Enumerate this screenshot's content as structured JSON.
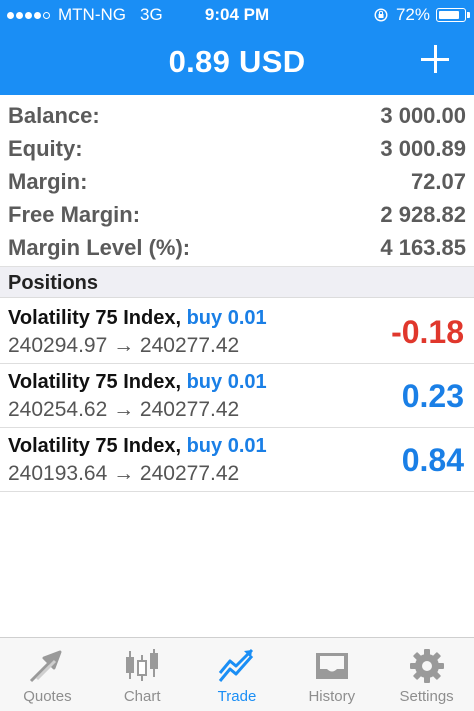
{
  "status_bar": {
    "carrier": "MTN-NG",
    "network": "3G",
    "time": "9:04 PM",
    "battery": "72%"
  },
  "header": {
    "title": "0.89 USD",
    "add_icon": "plus-icon"
  },
  "summary": [
    {
      "label": "Balance:",
      "value": "3 000.00"
    },
    {
      "label": "Equity:",
      "value": "3 000.89"
    },
    {
      "label": "Margin:",
      "value": "72.07"
    },
    {
      "label": "Free Margin:",
      "value": "2 928.82"
    },
    {
      "label": "Margin Level (%):",
      "value": "4 163.85"
    }
  ],
  "positions_header": "Positions",
  "positions": [
    {
      "symbol": "Volatility 75 Index,",
      "type": "buy 0.01",
      "prices": "240294.97 → 240277.42",
      "profit": "-0.18"
    },
    {
      "symbol": "Volatility 75 Index,",
      "type": "buy 0.01",
      "prices": "240254.62 → 240277.42",
      "profit": "0.23"
    },
    {
      "symbol": "Volatility 75 Index,",
      "type": "buy 0.01",
      "prices": "240193.64 → 240277.42",
      "profit": "0.84"
    }
  ],
  "tabs": [
    {
      "label": "Quotes",
      "icon": "quotes-arrows-icon"
    },
    {
      "label": "Chart",
      "icon": "candlestick-icon"
    },
    {
      "label": "Trade",
      "icon": "trend-line-icon"
    },
    {
      "label": "History",
      "icon": "inbox-tray-icon"
    },
    {
      "label": "Settings",
      "icon": "gear-icon"
    }
  ],
  "active_tab": "Trade",
  "colors": {
    "accent": "#1a8ef5",
    "loss": "#e0372c",
    "profit": "#1a7fe6"
  }
}
